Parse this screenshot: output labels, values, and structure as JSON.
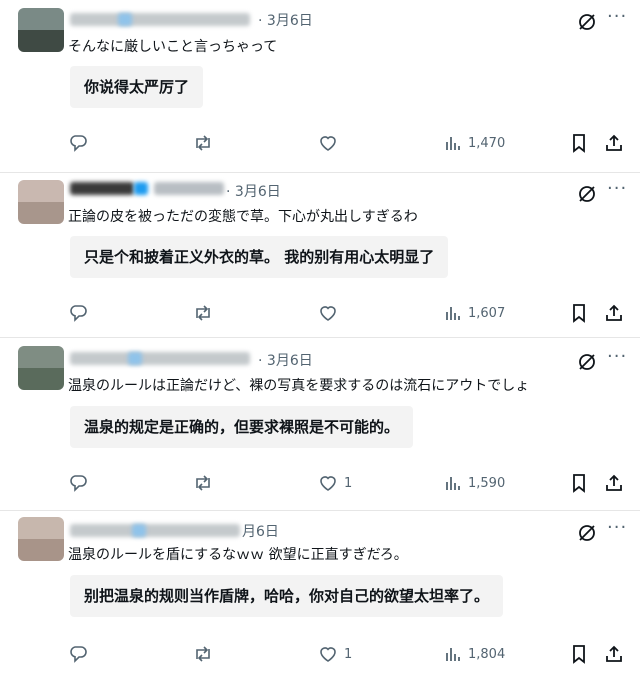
{
  "posts": [
    {
      "date": "3月6日",
      "handle": "",
      "text": "そんなに厳しいこと言っちゃって",
      "translation": "你说得太严厉了",
      "likes": "",
      "views": "1,470",
      "colors": {
        "top": "#7a8a86",
        "bottom": "#3f4a44"
      }
    },
    {
      "date": "3月6日",
      "handle": "@",
      "text": "正論の皮を被っただの変態で草。下心が丸出しすぎるわ",
      "translation": "只是个和披着正义外衣的草。 我的别有用心太明显了",
      "likes": "",
      "views": "1,607",
      "colors": {
        "top": "#c9b8b0",
        "bottom": "#a8968c"
      }
    },
    {
      "date": "3月6日",
      "handle": "",
      "text": "温泉のルールは正論だけど、裸の写真を要求するのは流石にアウトでしょ",
      "translation": "温泉的规定是正确的，但要求裸照是不可能的。",
      "likes": "1",
      "views": "1,590",
      "colors": {
        "top": "#7f8d83",
        "bottom": "#5a6b5c"
      }
    },
    {
      "date": "月6日",
      "handle": "",
      "text": "温泉のルールを盾にするなｗｗ 欲望に正直すぎだろ。",
      "translation": "别把温泉的规则当作盾牌，哈哈，你对自己的欲望太坦率了。",
      "likes": "1",
      "views": "1,804",
      "colors": {
        "top": "#c7b7ad",
        "bottom": "#a89489"
      }
    }
  ],
  "icons": {
    "reply": "reply-icon",
    "repost": "repost-icon",
    "like": "heart-icon",
    "views": "views-icon",
    "bookmark": "bookmark-icon",
    "share": "share-icon",
    "grok": "grok-icon",
    "more": "more-icon"
  },
  "accent": "#1d9bf0",
  "muted": "#536471"
}
